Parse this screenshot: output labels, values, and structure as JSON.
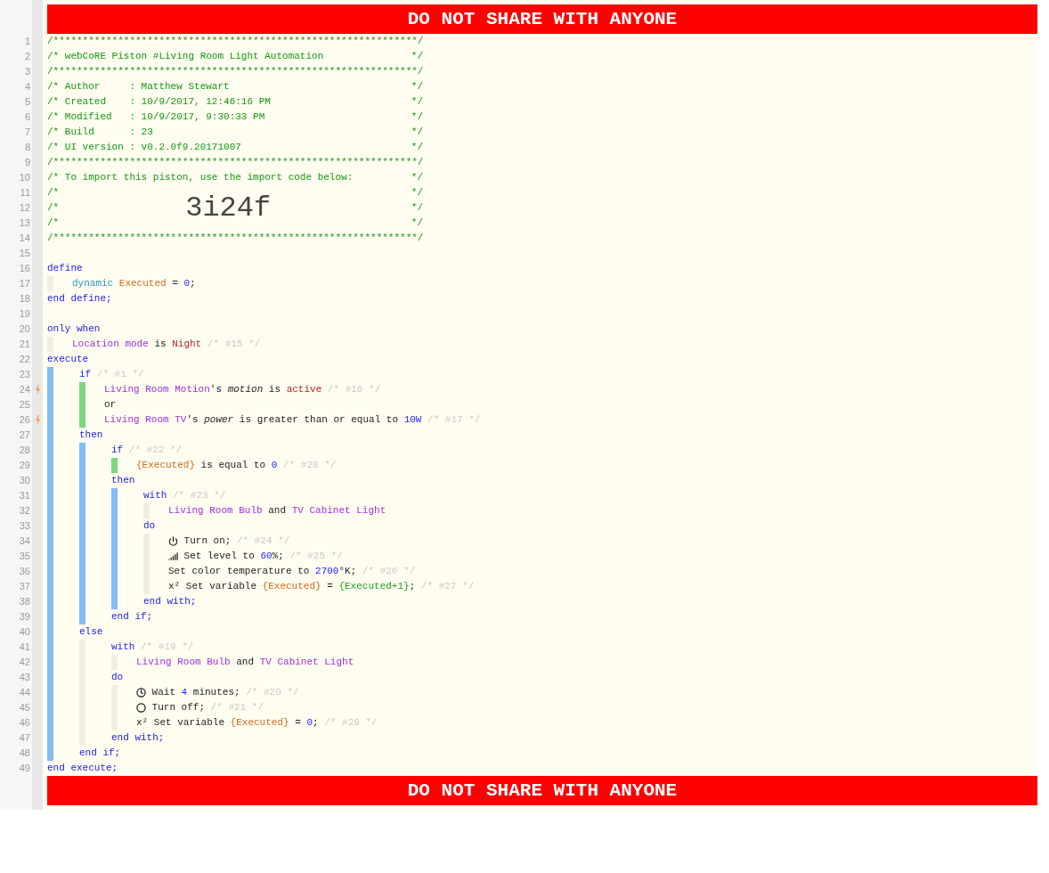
{
  "top_banner": "DO NOT SHARE WITH ANYONE",
  "lines": [
    {
      "n": "1",
      "tokens": [
        {
          "t": "/**************************************************************/",
          "kind": "header"
        }
      ]
    },
    {
      "n": "2",
      "tokens": [
        {
          "t": "/* webCoRE Piston #Living Room Light Automation",
          "kind": "header"
        },
        {
          "t": "*/",
          "kind": "header-end"
        }
      ]
    },
    {
      "n": "3",
      "tokens": [
        {
          "t": "/**************************************************************/",
          "kind": "header"
        }
      ]
    },
    {
      "n": "4",
      "tokens": [
        {
          "t": "/* Author     : Matthew Stewart",
          "kind": "header"
        },
        {
          "t": "*/",
          "kind": "header-end"
        }
      ]
    },
    {
      "n": "5",
      "tokens": [
        {
          "t": "/* Created    : 10/9/2017, 12:46:16 PM",
          "kind": "header"
        },
        {
          "t": "*/",
          "kind": "header-end"
        }
      ]
    },
    {
      "n": "6",
      "tokens": [
        {
          "t": "/* Modified   : 10/9/2017, 9:30:33 PM",
          "kind": "header"
        },
        {
          "t": "*/",
          "kind": "header-end"
        }
      ]
    },
    {
      "n": "7",
      "tokens": [
        {
          "t": "/* Build      : 23",
          "kind": "header"
        },
        {
          "t": "*/",
          "kind": "header-end"
        }
      ]
    },
    {
      "n": "8",
      "tokens": [
        {
          "t": "/* UI version : v0.2.0f9.20171007",
          "kind": "header"
        },
        {
          "t": "*/",
          "kind": "header-end"
        }
      ]
    },
    {
      "n": "9",
      "tokens": [
        {
          "t": "/**************************************************************/",
          "kind": "header"
        }
      ]
    },
    {
      "n": "10",
      "tokens": [
        {
          "t": "/* To import this piston, use the import code below:",
          "kind": "header"
        },
        {
          "t": "*/",
          "kind": "header-end"
        }
      ]
    },
    {
      "n": "11",
      "tokens": [
        {
          "t": "/*",
          "kind": "header"
        },
        {
          "t": "*/",
          "kind": "header-end"
        }
      ]
    },
    {
      "n": "12",
      "tokens": [
        {
          "t": "/*",
          "kind": "header"
        },
        {
          "t": "3i24f",
          "kind": "import-code"
        },
        {
          "t": "*/",
          "kind": "header-end"
        }
      ]
    },
    {
      "n": "13",
      "tokens": [
        {
          "t": "/*",
          "kind": "header"
        },
        {
          "t": "*/",
          "kind": "header-end"
        }
      ]
    },
    {
      "n": "14",
      "tokens": [
        {
          "t": "/**************************************************************/",
          "kind": "header"
        }
      ]
    },
    {
      "n": "15"
    },
    {
      "n": "16",
      "tokens": [
        {
          "t": "define",
          "kind": "keyword"
        }
      ]
    },
    {
      "n": "17",
      "guides": [
        {
          "kind": "plain"
        }
      ],
      "tokens": [
        {
          "t": "dynamic",
          "kind": "type"
        },
        {
          "t": "Executed",
          "kind": "variable"
        },
        {
          "t": "=",
          "kind": "text"
        },
        {
          "t": "0",
          "kind": "number"
        },
        {
          "t": ";",
          "kind": "text",
          "join": true
        }
      ]
    },
    {
      "n": "18",
      "tokens": [
        {
          "t": "end define;",
          "kind": "keyword"
        }
      ]
    },
    {
      "n": "19"
    },
    {
      "n": "20",
      "tokens": [
        {
          "t": "only when",
          "kind": "keyword"
        }
      ]
    },
    {
      "n": "21",
      "guides": [
        {
          "kind": "plain"
        }
      ],
      "tokens": [
        {
          "t": "Location mode",
          "kind": "device"
        },
        {
          "t": "is",
          "kind": "text"
        },
        {
          "t": "Night",
          "kind": "value"
        },
        {
          "t": "/* #15 */",
          "kind": "note"
        }
      ]
    },
    {
      "n": "22",
      "tokens": [
        {
          "t": "execute",
          "kind": "keyword"
        }
      ]
    },
    {
      "n": "23",
      "guides": [
        {
          "kind": "statement"
        }
      ],
      "tokens": [
        {
          "t": "if",
          "kind": "keyword"
        },
        {
          "t": "/* #1 */",
          "kind": "note"
        }
      ]
    },
    {
      "n": "24",
      "guides": [
        {
          "kind": "statement"
        },
        {
          "kind": "condition"
        }
      ],
      "trigger": true,
      "tokens": [
        {
          "t": "Living Room Motion",
          "kind": "device"
        },
        {
          "t": "'s",
          "kind": "text",
          "join": true
        },
        {
          "t": "motion",
          "kind": "attribute"
        },
        {
          "t": "is",
          "kind": "text"
        },
        {
          "t": "active",
          "kind": "value"
        },
        {
          "t": "/* #16 */",
          "kind": "note"
        }
      ]
    },
    {
      "n": "25",
      "guides": [
        {
          "kind": "statement"
        },
        {
          "kind": "condition"
        }
      ],
      "trigger": false,
      "tokens": [
        {
          "t": "or",
          "kind": "text"
        }
      ]
    },
    {
      "n": "26",
      "guides": [
        {
          "kind": "statement"
        },
        {
          "kind": "condition"
        }
      ],
      "trigger": true,
      "tokens": [
        {
          "t": "Living Room TV",
          "kind": "device"
        },
        {
          "t": "'s",
          "kind": "text",
          "join": true
        },
        {
          "t": "power",
          "kind": "attribute"
        },
        {
          "t": "is greater than or equal to",
          "kind": "text"
        },
        {
          "t": "10W",
          "kind": "number"
        },
        {
          "t": "/* #17 */",
          "kind": "note"
        }
      ]
    },
    {
      "n": "27",
      "guides": [
        {
          "kind": "statement"
        }
      ],
      "tokens": [
        {
          "t": "then",
          "kind": "keyword"
        }
      ]
    },
    {
      "n": "28",
      "guides": [
        {
          "kind": "statement"
        },
        {
          "kind": "statement"
        }
      ],
      "tokens": [
        {
          "t": "if",
          "kind": "keyword"
        },
        {
          "t": "/* #22 */",
          "kind": "note"
        }
      ]
    },
    {
      "n": "29",
      "guides": [
        {
          "kind": "statement"
        },
        {
          "kind": "statement"
        },
        {
          "kind": "condition"
        }
      ],
      "tokens": [
        {
          "t": "{Executed}",
          "kind": "variable"
        },
        {
          "t": "is equal to",
          "kind": "text"
        },
        {
          "t": "0",
          "kind": "number"
        },
        {
          "t": "/* #28 */",
          "kind": "note"
        }
      ]
    },
    {
      "n": "30",
      "guides": [
        {
          "kind": "statement"
        },
        {
          "kind": "statement"
        }
      ],
      "tokens": [
        {
          "t": "then",
          "kind": "keyword"
        }
      ]
    },
    {
      "n": "31",
      "guides": [
        {
          "kind": "statement"
        },
        {
          "kind": "statement"
        },
        {
          "kind": "statement"
        }
      ],
      "tokens": [
        {
          "t": "with",
          "kind": "keyword"
        },
        {
          "t": "/* #23 */",
          "kind": "note"
        }
      ]
    },
    {
      "n": "32",
      "guides": [
        {
          "kind": "statement"
        },
        {
          "kind": "statement"
        },
        {
          "kind": "statement"
        },
        {
          "kind": "plain"
        }
      ],
      "tokens": [
        {
          "t": "Living Room Bulb",
          "kind": "device"
        },
        {
          "t": "and",
          "kind": "text"
        },
        {
          "t": "TV Cabinet Light",
          "kind": "device"
        }
      ]
    },
    {
      "n": "33",
      "guides": [
        {
          "kind": "statement"
        },
        {
          "kind": "statement"
        },
        {
          "kind": "statement"
        }
      ],
      "tokens": [
        {
          "t": "do",
          "kind": "keyword"
        }
      ]
    },
    {
      "n": "34",
      "guides": [
        {
          "kind": "statement"
        },
        {
          "kind": "statement"
        },
        {
          "kind": "statement"
        },
        {
          "kind": "plain"
        }
      ],
      "tokens": [
        {
          "kind": "power"
        },
        {
          "t": "Turn on;",
          "kind": "text"
        },
        {
          "t": "/* #24 */",
          "kind": "note"
        }
      ]
    },
    {
      "n": "35",
      "guides": [
        {
          "kind": "statement"
        },
        {
          "kind": "statement"
        },
        {
          "kind": "statement"
        },
        {
          "kind": "plain"
        }
      ],
      "tokens": [
        {
          "kind": "signal"
        },
        {
          "t": "Set level to",
          "kind": "text"
        },
        {
          "t": "60",
          "kind": "number"
        },
        {
          "t": "%;",
          "kind": "text",
          "join": true
        },
        {
          "t": "/* #25 */",
          "kind": "note"
        }
      ]
    },
    {
      "n": "36",
      "guides": [
        {
          "kind": "statement"
        },
        {
          "kind": "statement"
        },
        {
          "kind": "statement"
        },
        {
          "kind": "plain"
        }
      ],
      "tokens": [
        {
          "t": "Set color temperature to",
          "kind": "text"
        },
        {
          "t": "2700",
          "kind": "number"
        },
        {
          "t": "°K;",
          "kind": "text",
          "join": true
        },
        {
          "t": "/* #26 */",
          "kind": "note"
        }
      ]
    },
    {
      "n": "37",
      "guides": [
        {
          "kind": "statement"
        },
        {
          "kind": "statement"
        },
        {
          "kind": "statement"
        },
        {
          "kind": "plain"
        }
      ],
      "tokens": [
        {
          "t": "x²",
          "kind": "text"
        },
        {
          "t": "Set variable",
          "kind": "text"
        },
        {
          "t": "{Executed}",
          "kind": "variable"
        },
        {
          "t": "=",
          "kind": "text"
        },
        {
          "t": "{Executed+1}",
          "kind": "expression"
        },
        {
          "t": ";",
          "kind": "text",
          "join": true
        },
        {
          "t": "/* #27 */",
          "kind": "note"
        }
      ]
    },
    {
      "n": "38",
      "guides": [
        {
          "kind": "statement"
        },
        {
          "kind": "statement"
        },
        {
          "kind": "statement"
        }
      ],
      "tokens": [
        {
          "t": "end with;",
          "kind": "keyword"
        }
      ]
    },
    {
      "n": "39",
      "guides": [
        {
          "kind": "statement"
        },
        {
          "kind": "statement"
        }
      ],
      "tokens": [
        {
          "t": "end if;",
          "kind": "keyword"
        }
      ]
    },
    {
      "n": "40",
      "guides": [
        {
          "kind": "statement"
        }
      ],
      "tokens": [
        {
          "t": "else",
          "kind": "keyword"
        }
      ]
    },
    {
      "n": "41",
      "guides": [
        {
          "kind": "statement"
        },
        {
          "kind": "block"
        }
      ],
      "tokens": [
        {
          "t": "with",
          "kind": "keyword"
        },
        {
          "t": "/* #19 */",
          "kind": "note"
        }
      ]
    },
    {
      "n": "42",
      "guides": [
        {
          "kind": "statement"
        },
        {
          "kind": "block"
        },
        {
          "kind": "plain"
        }
      ],
      "tokens": [
        {
          "t": "Living Room Bulb",
          "kind": "device"
        },
        {
          "t": "and",
          "kind": "text"
        },
        {
          "t": "TV Cabinet Light",
          "kind": "device"
        }
      ]
    },
    {
      "n": "43",
      "guides": [
        {
          "kind": "statement"
        },
        {
          "kind": "block"
        }
      ],
      "tokens": [
        {
          "t": "do",
          "kind": "keyword"
        }
      ]
    },
    {
      "n": "44",
      "guides": [
        {
          "kind": "statement"
        },
        {
          "kind": "block"
        },
        {
          "kind": "plain"
        }
      ],
      "tokens": [
        {
          "kind": "clock"
        },
        {
          "t": "Wait",
          "kind": "text"
        },
        {
          "t": "4",
          "kind": "number"
        },
        {
          "t": "minutes;",
          "kind": "text"
        },
        {
          "t": "/* #20 */",
          "kind": "note"
        }
      ]
    },
    {
      "n": "45",
      "guides": [
        {
          "kind": "statement"
        },
        {
          "kind": "block"
        },
        {
          "kind": "plain"
        }
      ],
      "tokens": [
        {
          "kind": "circle"
        },
        {
          "t": "Turn off;",
          "kind": "text"
        },
        {
          "t": "/* #21 */",
          "kind": "note"
        }
      ]
    },
    {
      "n": "46",
      "guides": [
        {
          "kind": "statement"
        },
        {
          "kind": "block"
        },
        {
          "kind": "plain"
        }
      ],
      "tokens": [
        {
          "t": "x²",
          "kind": "text"
        },
        {
          "t": "Set variable",
          "kind": "text"
        },
        {
          "t": "{Executed}",
          "kind": "variable"
        },
        {
          "t": "=",
          "kind": "text"
        },
        {
          "t": "0",
          "kind": "number"
        },
        {
          "t": ";",
          "kind": "text",
          "join": true
        },
        {
          "t": "/* #29 */",
          "kind": "note"
        }
      ]
    },
    {
      "n": "47",
      "guides": [
        {
          "kind": "statement"
        },
        {
          "kind": "block"
        }
      ],
      "tokens": [
        {
          "t": "end with;",
          "kind": "keyword"
        }
      ]
    },
    {
      "n": "48",
      "guides": [
        {
          "kind": "statement"
        }
      ],
      "tokens": [
        {
          "t": "end if;",
          "kind": "keyword"
        }
      ]
    },
    {
      "n": "49",
      "tokens": [
        {
          "t": "end execute;",
          "kind": "keyword"
        }
      ]
    }
  ],
  "bottom_banner": "DO NOT SHARE WITH ANYONE"
}
